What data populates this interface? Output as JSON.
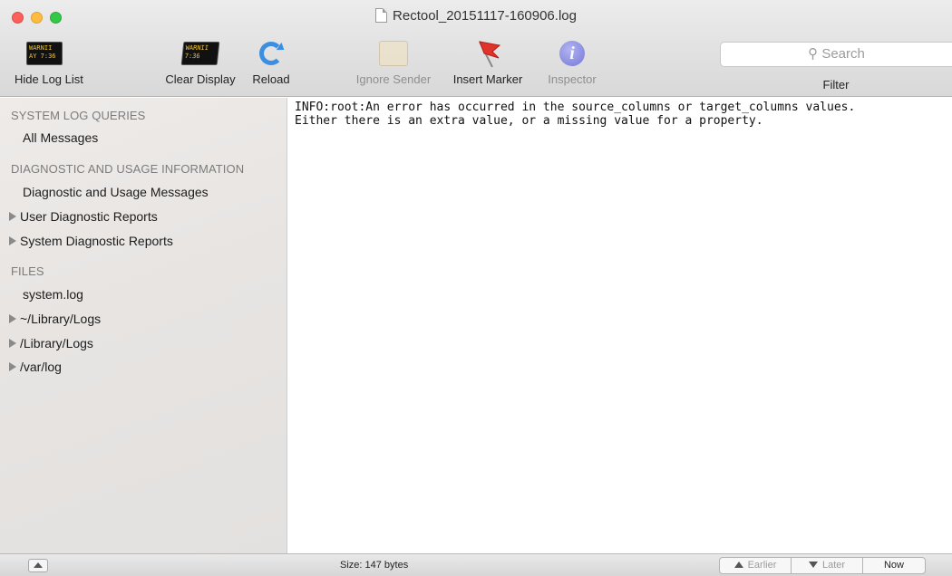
{
  "window": {
    "title": "Rectool_20151117-160906.log"
  },
  "toolbar": {
    "hide_log_list": "Hide Log List",
    "clear_display": "Clear Display",
    "reload": "Reload",
    "ignore_sender": "Ignore Sender",
    "insert_marker": "Insert Marker",
    "inspector": "Inspector",
    "search_placeholder": "Search",
    "filter_label": "Filter",
    "console_icon_text_1": "WARNII",
    "console_icon_text_2": "AY 7:36",
    "clear_icon_text_1": "WARNII",
    "clear_icon_text_2": "7:36"
  },
  "sidebar": {
    "section_queries": "SYSTEM LOG QUERIES",
    "all_messages": "All Messages",
    "section_diagnostic": "DIAGNOSTIC AND USAGE INFORMATION",
    "diagnostic_messages": "Diagnostic and Usage Messages",
    "user_reports": "User Diagnostic Reports",
    "system_reports": "System Diagnostic Reports",
    "section_files": "FILES",
    "system_log": "system.log",
    "user_library_logs": "~/Library/Logs",
    "library_logs": "/Library/Logs",
    "var_log": "/var/log"
  },
  "log": {
    "content": "INFO:root:An error has occurred in the source_columns or target_columns values.\nEither there is an extra value, or a missing value for a property."
  },
  "statusbar": {
    "size": "Size: 147 bytes",
    "earlier": "Earlier",
    "later": "Later",
    "now": "Now"
  }
}
